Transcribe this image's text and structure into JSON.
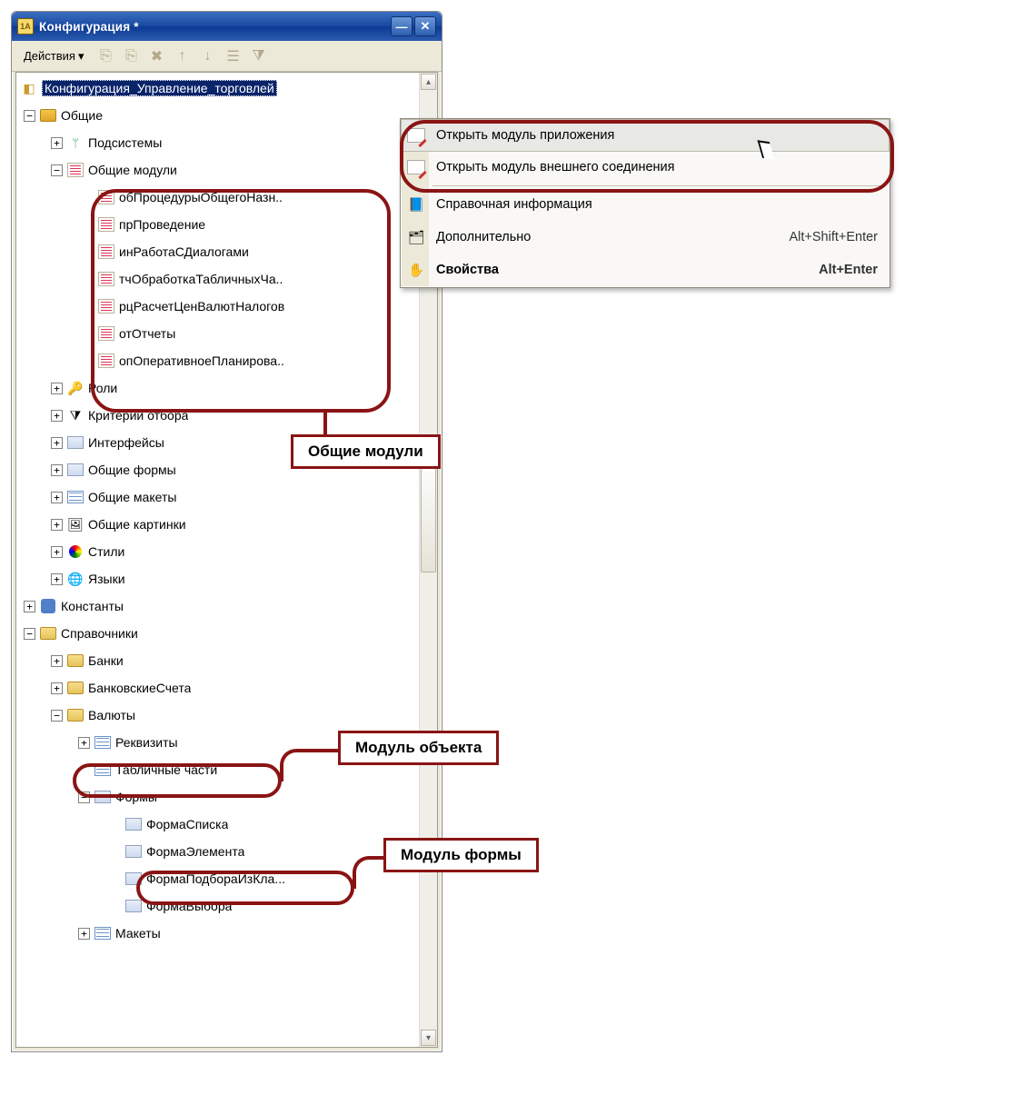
{
  "window": {
    "title": "Конфигурация *"
  },
  "toolbar": {
    "actions_label": "Действия"
  },
  "tree": {
    "root": "Конфигурация_Управление_торговлей",
    "common": "Общие",
    "subsystems": "Подсистемы",
    "common_modules": "Общие модули",
    "modules": [
      "обПроцедурыОбщегоНазн..",
      "прПроведение",
      "инРаботаСДиалогами",
      "тчОбработкаТабличныхЧа..",
      "рцРасчетЦенВалютНалогов",
      "отОтчеты",
      "опОперативноеПланирова.."
    ],
    "roles": "Роли",
    "criteria": "Критерии отбора",
    "interfaces": "Интерфейсы",
    "common_forms": "Общие формы",
    "common_templates": "Общие макеты",
    "common_pictures": "Общие картинки",
    "styles": "Стили",
    "languages": "Языки",
    "constants": "Константы",
    "catalogs": "Справочники",
    "banks": "Банки",
    "bank_accounts": "БанковскиеСчета",
    "currencies": "Валюты",
    "attributes": "Реквизиты",
    "tabular": "Табличные части",
    "forms": "Формы",
    "form_items": [
      "ФормаСписка",
      "ФормаЭлемента",
      "ФормаПодбораИзКла...",
      "ФормаВыбора"
    ],
    "layouts": "Макеты"
  },
  "context_menu": {
    "open_app_module": "Открыть модуль приложения",
    "open_ext_module": "Открыть модуль внешнего соединения",
    "help_info": "Справочная информация",
    "additional": "Дополнительно",
    "additional_shortcut": "Alt+Shift+Enter",
    "properties": "Свойства",
    "properties_shortcut": "Alt+Enter"
  },
  "callouts": {
    "common_modules": "Общие модули",
    "object_module": "Модуль объекта",
    "form_module": "Модуль формы"
  }
}
